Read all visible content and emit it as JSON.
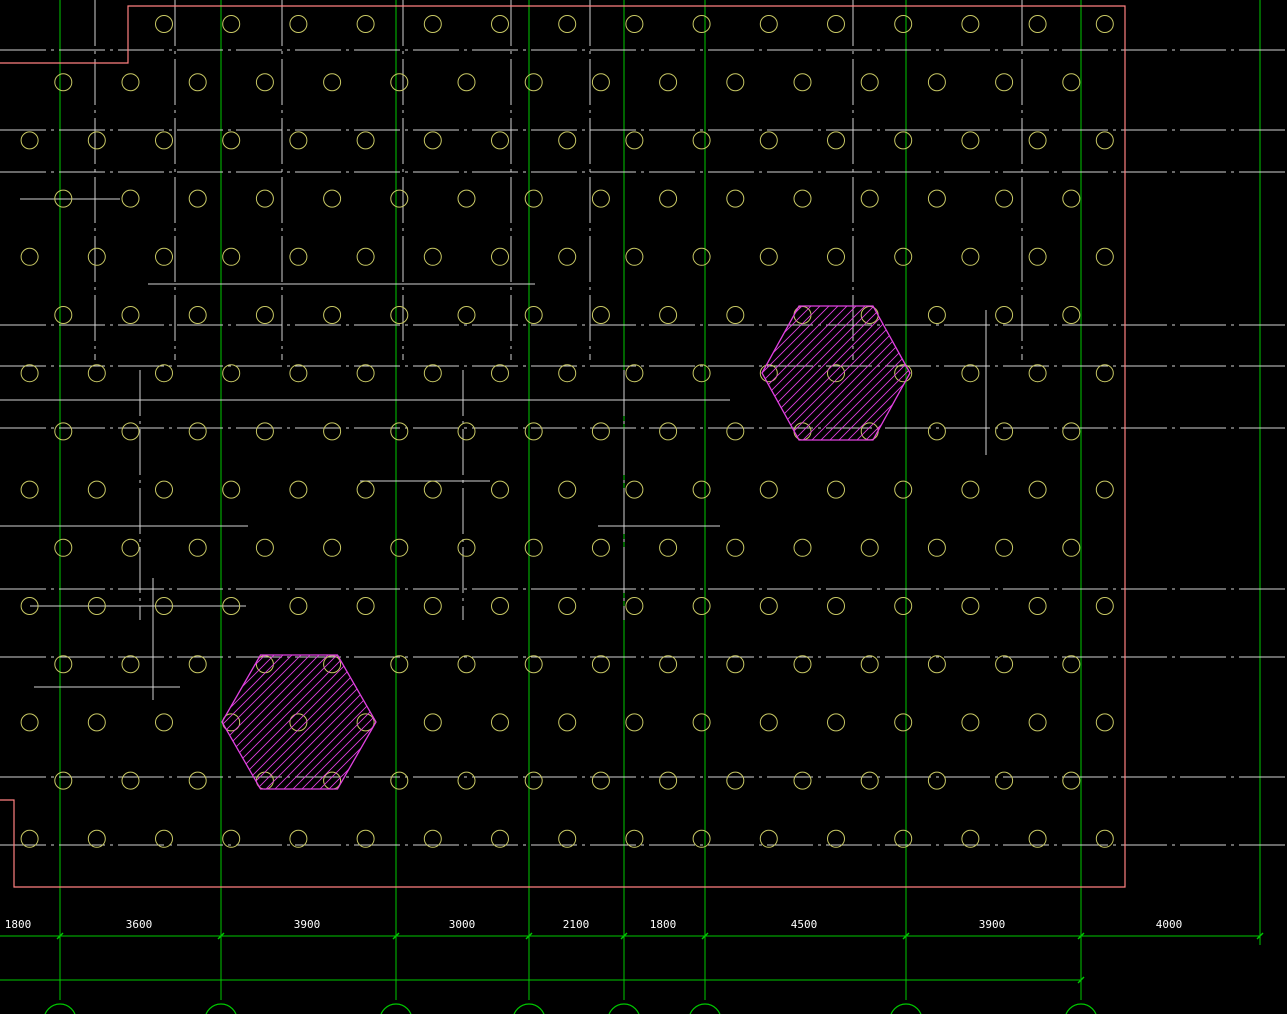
{
  "colors": {
    "background": "#000000",
    "grid_axis": "#00c800",
    "dash_line": "#d2d2d2",
    "pile_circle": "#c8c864",
    "boundary": "#ff8080",
    "hatch": "#e040e0",
    "dimension_line": "#00c800",
    "dimension_text": "#ffffff"
  },
  "dimensions": [
    "1800",
    "3600",
    "3900",
    "3000",
    "2100",
    "1800",
    "4500",
    "3900",
    "4000"
  ],
  "hatched_regions": [
    {
      "name": "hatched-hexagon-upper-right"
    },
    {
      "name": "hatched-hexagon-lower-left"
    }
  ]
}
